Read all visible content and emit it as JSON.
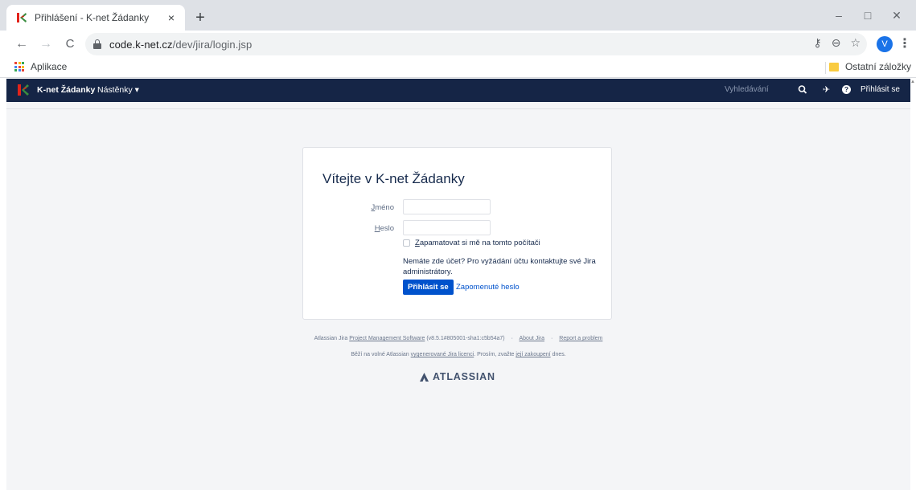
{
  "browser": {
    "tab_title": "Přihlášení - K-net Žádanky",
    "tab_close": "×",
    "new_tab": "+",
    "url_host": "code.k-net.cz",
    "url_path": "/dev/jira/login.jsp",
    "profile_initial": "V",
    "window_controls": {
      "minimize": "–",
      "maximize": "□",
      "close": "✕"
    },
    "nav": {
      "back": "←",
      "forward": "→",
      "reload": "C"
    }
  },
  "bookmarks": {
    "apps_label": "Aplikace",
    "other_label": "Ostatní záložky",
    "apps_colors": [
      "#ea4335",
      "#fbbc04",
      "#34a853",
      "#4285f4",
      "#ea4335",
      "#fbbc04",
      "#34a853",
      "#4285f4",
      "#ea4335"
    ]
  },
  "jira_header": {
    "brand": "K-net Žádanky",
    "nav_label": "Nástěnky ▾",
    "search_placeholder": "Vyhledávání",
    "login_label": "Přihlásit se",
    "help_label": "?",
    "background": "#152546"
  },
  "login": {
    "title": "Vítejte v K-net Žádanky",
    "username_label_accesskey": "J",
    "username_label_rest": "méno",
    "password_label_accesskey": "H",
    "password_label_rest": "eslo",
    "remember_accesskey": "Z",
    "remember_rest": "apamatovat si mě na tomto počítači",
    "info_text": "Nemáte zde účet? Pro vyžádání účtu kontaktujte své Jira administrátory.",
    "submit_label": "Přihlásit se",
    "forgot_label": "Zapomenuté heslo",
    "accent_color": "#0052cc"
  },
  "footer": {
    "line1_prefix": "Atlassian Jira",
    "line1_link1": "Project Management Software",
    "line1_version": "(v8.5.1#805001-sha1:c5b54a7)",
    "line1_sep": "·",
    "line1_link2": "About Jira",
    "line1_link3": "Report a problem",
    "line2_prefix": "Běží na volné Atlassian",
    "line2_link1": "vygenerované Jira licenci",
    "line2_middle": ". Prosím, zvažte",
    "line2_link2": "její zakoupení",
    "line2_suffix": "dnes.",
    "atlassian_logo": "ATLASSIAN"
  },
  "icons": {
    "favicon": "k-net-logo-icon",
    "key": "key-icon",
    "zoom": "zoom-icon",
    "star": "star-icon",
    "search": "search-icon",
    "feedback": "megaphone-icon",
    "help": "help-icon"
  }
}
